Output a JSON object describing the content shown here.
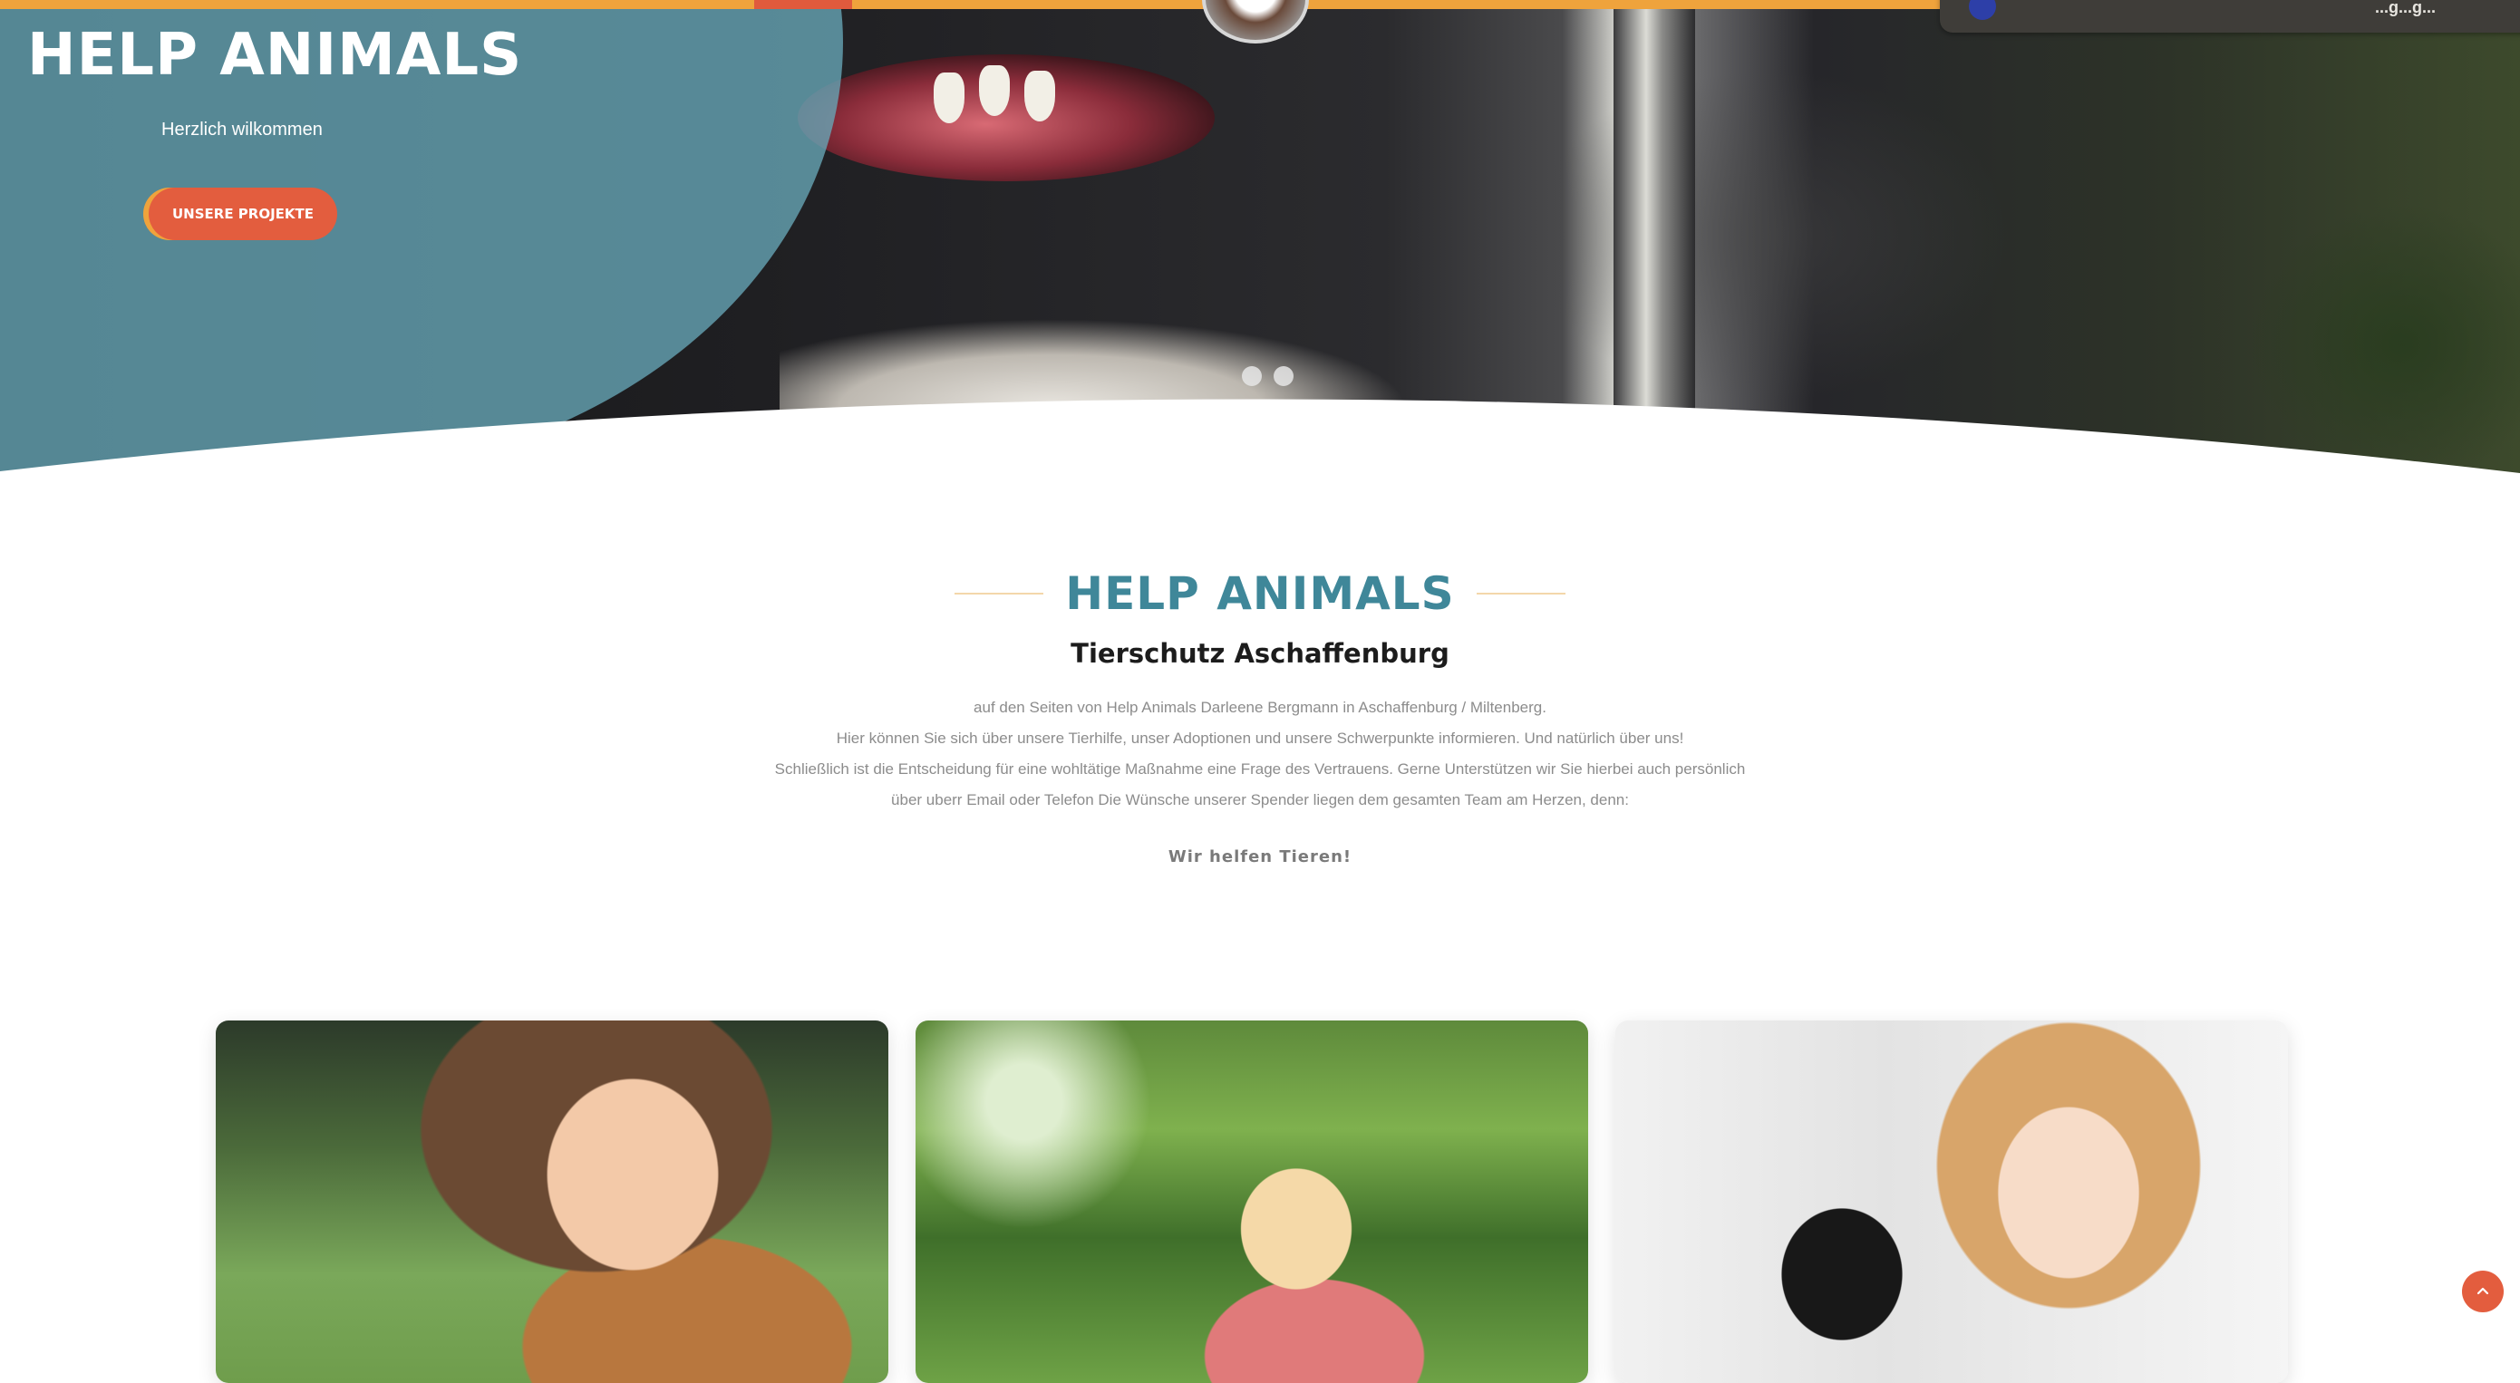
{
  "hero": {
    "title": "HELP ANIMALS",
    "subtitle": "Herzlich wilkommen",
    "button_label": "UNSERE PROJEKTE",
    "slides": 2
  },
  "intro": {
    "title": "HELP ANIMALS",
    "subtitle": "Tierschutz Aschaffenburg",
    "lines": [
      "auf den Seiten von Help Animals Darleene Bergmann in Aschaffenburg / Miltenberg.",
      "Hier können Sie sich über unsere Tierhilfe, unser Adoptionen und unsere Schwerpunkte informieren. Und natürlich über uns!",
      "Schließlich ist die Entscheidung für eine wohltätige Maßnahme eine Frage des Vertrauens. Gerne Unterstützen wir Sie hierbei auch persönlich",
      "über uberr Email oder Telefon Die Wünsche unserer Spender liegen dem gesamten Team am Herzen, denn:"
    ],
    "motto": "Wir helfen Tieren!"
  },
  "cards": [
    {
      "image": "girl-with-dog-photo"
    },
    {
      "image": "child-in-grass-photo"
    },
    {
      "image": "girl-with-black-rabbit-photo"
    }
  ],
  "notice": {
    "text": "...g...g..."
  },
  "icons": {
    "back_to_top": "chevron-up-icon"
  },
  "colors": {
    "accent_orange": "#efa33c",
    "accent_red": "#e35d3e",
    "teal": "#3f8799",
    "hero_blue": "#68a8b9"
  }
}
